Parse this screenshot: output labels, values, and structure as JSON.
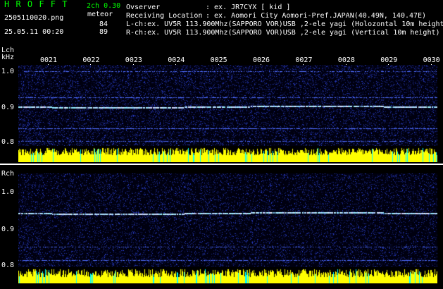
{
  "header": {
    "title": "H R O F F T",
    "version": "2ch 0.30",
    "filename": "2505110020.png",
    "mode": "meteor",
    "datetime": "25.05.11 00:20",
    "lch_count": "84",
    "rch_count": "89",
    "observer_label": "Ovserver",
    "observer_value": ": ex. JR7CYX [ kid ]",
    "location_label": "Receiving Location",
    "location_value": ": ex. Aomori City Aomori-Pref.JAPAN(40.49N, 140.47E)",
    "lch_info": "L-ch:ex. UV5R 113.900Mhz(SAPPORO VOR)USB ,2-ele yagi (Holozontal 10m height",
    "rch_info": "R-ch:ex. UV5R 113.900Mhz(SAPPORO VOR)USB ,2-ele yagi (Vertical 10m height)"
  },
  "time_labels": [
    "0021",
    "0022",
    "0023",
    "0024",
    "0025",
    "0026",
    "0027",
    "0028",
    "0029",
    "0030"
  ],
  "lch": {
    "label": "Lch",
    "unit": "kHz",
    "yticks": [
      "1.0",
      "0.9",
      "0.8"
    ]
  },
  "rch": {
    "label": "Rch",
    "yticks": [
      "1.0",
      "0.9",
      "0.8"
    ]
  },
  "colors": {
    "title_green": "#00ff00",
    "spectrum_bg": "#000040",
    "signal_line": "#a0e0ff",
    "bars_yellow": "#ffff00",
    "bars_cyan": "#00ffff"
  }
}
